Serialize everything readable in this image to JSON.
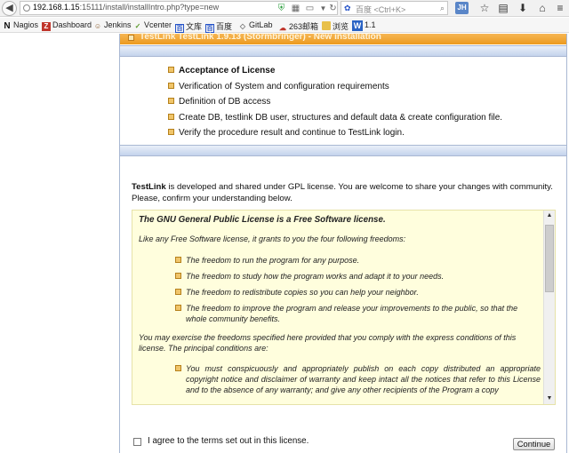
{
  "browser": {
    "url_host": "192.168.1.15",
    "url_rest": ":15111/install/installIntro.php?type=new",
    "search_placeholder": "百度 <Ctrl+K>",
    "account_initials": "JH",
    "icons": {
      "back": "back-arrow-icon",
      "security": "shield-icon",
      "qr": "qr-code-icon",
      "reader": "reader-view-icon",
      "dropdown": "chevron-down-icon",
      "reload": "reload-icon",
      "search_engine": "paw-icon",
      "search_go": "search-icon",
      "star": "star-icon",
      "clipboard": "clipboard-icon",
      "download": "download-icon",
      "home": "home-icon",
      "menu": "menu-icon"
    }
  },
  "bookmarks": [
    {
      "label": "Nagios",
      "icon": "N"
    },
    {
      "label": "Dashboard",
      "icon": "Z"
    },
    {
      "label": "Jenkins",
      "icon": "☺"
    },
    {
      "label": "Vcenter",
      "icon": "✓"
    },
    {
      "label": "文库",
      "icon": "百"
    },
    {
      "label": "百度",
      "icon": "百"
    },
    {
      "label": "GitLab",
      "icon": "◇"
    },
    {
      "label": "263邮箱",
      "icon": "☁"
    },
    {
      "label": "浏览",
      "icon": ""
    },
    {
      "label": "1.1",
      "icon": "W"
    }
  ],
  "page": {
    "title": "TestLink TestLink 1.9.13 (Stormbringer) - New installation",
    "steps": [
      {
        "label": "Acceptance of License",
        "current": true
      },
      {
        "label": "Verification of System and configuration requirements",
        "current": false
      },
      {
        "label": "Definition of DB access",
        "current": false
      },
      {
        "label": "Create DB, testlink DB user, structures and default data & create configuration file.",
        "current": false
      },
      {
        "label": "Verify the procedure result and continue to TestLink login.",
        "current": false
      }
    ],
    "intro_bold": "TestLink",
    "intro_rest": " is developed and shared under GPL license. You are welcome to share your changes with community. Please, confirm your understanding below.",
    "license": {
      "heading": "The GNU General Public License is a Free Software license.",
      "intro": "Like any Free Software license, it grants to you the four following freedoms:",
      "freedoms": [
        "The freedom to run the program for any purpose.",
        "The freedom to study how the program works and adapt it to your needs.",
        "The freedom to redistribute copies so you can help your neighbor.",
        "The freedom to improve the program and release your improvements to the public, so that the whole community benefits."
      ],
      "exercise": "You may exercise the freedoms specified here provided that you comply with the express conditions of this license. The principal conditions are:",
      "conditions": [
        "You must conspicuously and appropriately publish on each copy distributed an appropriate copyright notice and disclaimer of warranty and keep intact all the notices that refer to this License and to the absence of any warranty; and give any other recipients of the Program a copy"
      ]
    },
    "agree_label": "I agree to the terms set out in this license.",
    "agree_checked": false,
    "continue_label": "Continue"
  }
}
